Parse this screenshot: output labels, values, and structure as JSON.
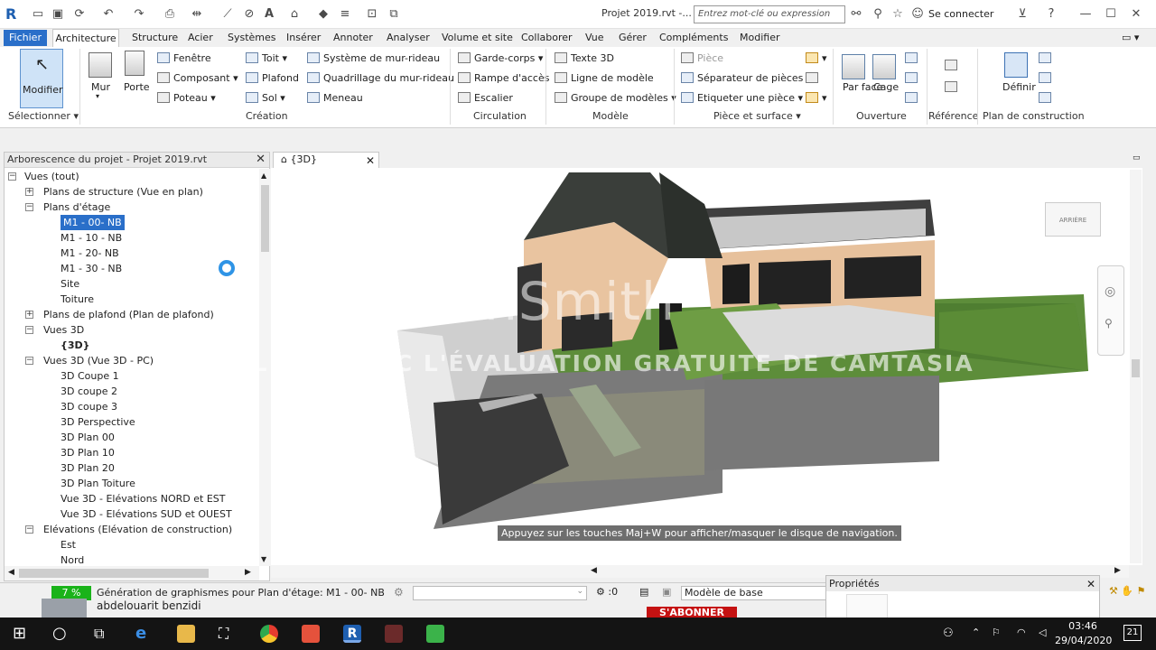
{
  "titlebar": {
    "app_logo": "R",
    "document_title": "Projet 2019.rvt -...",
    "search_placeholder": "Entrez mot-clé ou expression",
    "sign_in": "Se connecter",
    "help": "?"
  },
  "menu_tabs": [
    "Fichier",
    "Architecture",
    "Structure",
    "Acier",
    "Systèmes",
    "Insérer",
    "Annoter",
    "Analyser",
    "Volume et site",
    "Collaborer",
    "Vue",
    "Gérer",
    "Compléments",
    "Modifier"
  ],
  "ribbon": {
    "select": {
      "modify": "Modifier",
      "panel": "Sélectionner"
    },
    "build": {
      "wall": "Mur",
      "door": "Porte",
      "window": "Fenêtre",
      "component": "Composant",
      "column": "Poteau",
      "roof": "Toit",
      "ceiling": "Plafond",
      "floor": "Sol",
      "curtain_system": "Système de mur-rideau",
      "curtain_grid": "Quadrillage du mur-rideau",
      "mullion": "Meneau",
      "panel": "Création"
    },
    "circulation": {
      "railing": "Garde-corps",
      "ramp": "Rampe d'accès",
      "stair": "Escalier",
      "panel": "Circulation"
    },
    "model": {
      "model_text": "Texte 3D",
      "model_line": "Ligne de modèle",
      "model_group": "Groupe de modèles",
      "panel": "Modèle"
    },
    "room": {
      "room": "Pièce",
      "room_separator": "Séparateur de pièces",
      "tag_room": "Etiqueter une pièce",
      "panel": "Pièce et surface"
    },
    "opening": {
      "by_face": "Par face",
      "shaft": "Cage",
      "panel": "Ouverture"
    },
    "datum": {
      "panel": "Référence"
    },
    "work_plane": {
      "set": "Définir",
      "panel": "Plan de construction"
    }
  },
  "project_browser": {
    "title": "Arborescence du projet - Projet 2019.rvt",
    "items": [
      {
        "label": "Vues (tout)"
      },
      {
        "label": "Plans de structure (Vue en plan)"
      },
      {
        "label": "Plans d'étage"
      },
      {
        "label": "M1 - 00- NB"
      },
      {
        "label": "M1 - 10 - NB"
      },
      {
        "label": "M1 - 20- NB"
      },
      {
        "label": "M1 - 30 - NB"
      },
      {
        "label": "Site"
      },
      {
        "label": "Toiture"
      },
      {
        "label": "Plans de plafond (Plan de plafond)"
      },
      {
        "label": "Vues 3D"
      },
      {
        "label": "{3D}"
      },
      {
        "label": "Vues 3D (Vue 3D - PC)"
      },
      {
        "label": "3D Coupe 1"
      },
      {
        "label": "3D coupe 2"
      },
      {
        "label": "3D coupe 3"
      },
      {
        "label": "3D Perspective"
      },
      {
        "label": "3D Plan 00"
      },
      {
        "label": "3D Plan 10"
      },
      {
        "label": "3D Plan 20"
      },
      {
        "label": "3D Plan Toiture"
      },
      {
        "label": "Vue 3D - Elévations NORD et EST"
      },
      {
        "label": "Vue 3D - Elévations SUD et OUEST"
      },
      {
        "label": "Elévations (Elévation de construction)"
      },
      {
        "label": "Est"
      },
      {
        "label": "Nord"
      }
    ]
  },
  "view": {
    "tab_label": "{3D}",
    "viewcube_label": "ARRIÈRE",
    "nav_tooltip": "Appuyez sur les touches Maj+W pour afficher/masquer le disque de navigation.",
    "watermark_logo": "TechSmith",
    "watermark_text": "RÉALISÉE AVEC L'ÉVALUATION GRATUITE DE CAMTASIA"
  },
  "statusbar": {
    "progress": "7 %",
    "progress_value": 0.07,
    "message": "Génération de graphismes pour Plan d'étage: M1 - 00- NB",
    "selection_count": ":0",
    "design_option": "Modèle de base"
  },
  "properties": {
    "title": "Propriétés"
  },
  "overlay": {
    "user_name": "abdelouarit benzidi",
    "subscribe": "S'ABONNER"
  },
  "taskbar": {
    "time": "03:46",
    "date": "29/04/2020",
    "notifications": "21"
  }
}
